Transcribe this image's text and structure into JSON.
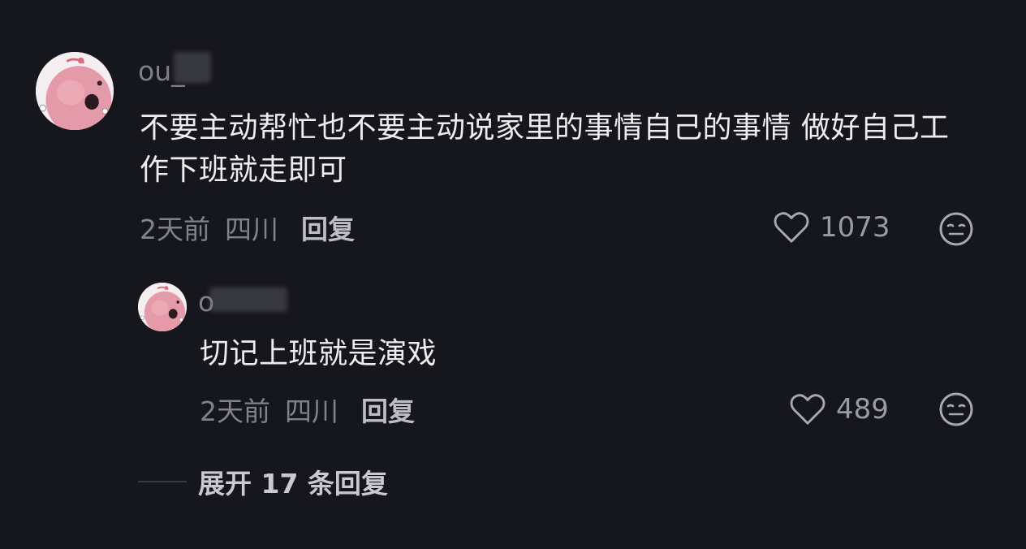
{
  "comment": {
    "username": "ou_",
    "text": "不要主动帮忙也不要主动说家里的事情自己的事情 做好自己工作下班就走即可",
    "time": "2天前",
    "location": "四川",
    "reply_label": "回复",
    "like_count": "1073",
    "like_icon": "heart-outline-icon",
    "dislike_icon": "neutral-face-icon"
  },
  "reply": {
    "username": "o",
    "text": "切记上班就是演戏",
    "time": "2天前",
    "location": "四川",
    "reply_label": "回复",
    "like_count": "489",
    "like_icon": "heart-outline-icon",
    "dislike_icon": "neutral-face-icon"
  },
  "expand": {
    "label": "展开 17 条回复"
  },
  "colors": {
    "background": "#16161d",
    "text_primary": "#ededf0",
    "text_secondary": "#82828b",
    "avatar_pink": "#e79aa8"
  }
}
